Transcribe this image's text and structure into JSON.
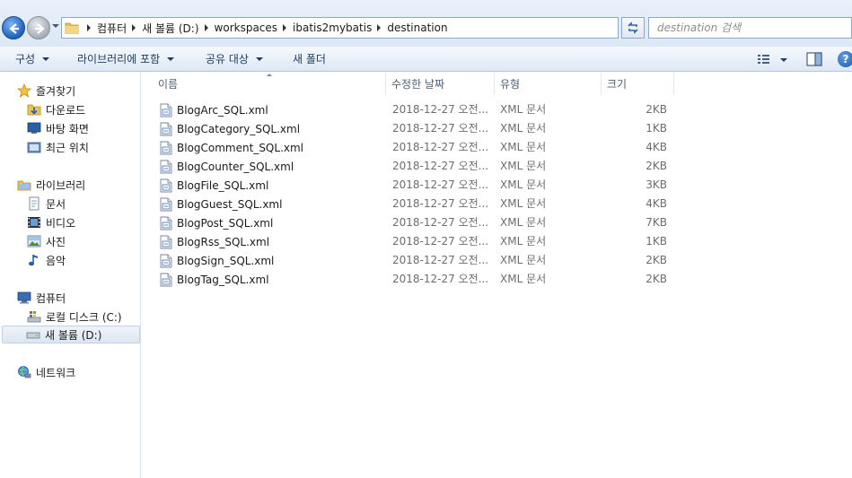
{
  "address": {
    "crumbs": [
      "컴퓨터",
      "새 볼륨 (D:)",
      "workspaces",
      "ibatis2mybatis",
      "destination"
    ]
  },
  "search": {
    "placeholder": "destination 검색"
  },
  "toolbar": {
    "organize": "구성",
    "include_library": "라이브러리에 포함",
    "share": "공유 대상",
    "new_folder": "새 폴더",
    "help": "?"
  },
  "nav": {
    "favorites": "즐겨찾기",
    "downloads": "다운로드",
    "desktop": "바탕 화면",
    "recent": "최근 위치",
    "libraries": "라이브러리",
    "documents": "문서",
    "videos": "비디오",
    "pictures": "사진",
    "music": "음악",
    "computer": "컴퓨터",
    "local_disk": "로컬 디스크 (C:)",
    "new_volume": "새 볼륨 (D:)",
    "network": "네트워크"
  },
  "columns": {
    "name": "이름",
    "modified": "수정한 날짜",
    "type": "유형",
    "size": "크기"
  },
  "files": [
    {
      "name": "BlogArc_SQL.xml",
      "date": "2018-12-27 오전...",
      "type": "XML 문서",
      "size": "2KB"
    },
    {
      "name": "BlogCategory_SQL.xml",
      "date": "2018-12-27 오전...",
      "type": "XML 문서",
      "size": "1KB"
    },
    {
      "name": "BlogComment_SQL.xml",
      "date": "2018-12-27 오전...",
      "type": "XML 문서",
      "size": "4KB"
    },
    {
      "name": "BlogCounter_SQL.xml",
      "date": "2018-12-27 오전...",
      "type": "XML 문서",
      "size": "2KB"
    },
    {
      "name": "BlogFile_SQL.xml",
      "date": "2018-12-27 오전...",
      "type": "XML 문서",
      "size": "3KB"
    },
    {
      "name": "BlogGuest_SQL.xml",
      "date": "2018-12-27 오전...",
      "type": "XML 문서",
      "size": "4KB"
    },
    {
      "name": "BlogPost_SQL.xml",
      "date": "2018-12-27 오전...",
      "type": "XML 문서",
      "size": "7KB"
    },
    {
      "name": "BlogRss_SQL.xml",
      "date": "2018-12-27 오전...",
      "type": "XML 문서",
      "size": "1KB"
    },
    {
      "name": "BlogSign_SQL.xml",
      "date": "2018-12-27 오전...",
      "type": "XML 문서",
      "size": "2KB"
    },
    {
      "name": "BlogTag_SQL.xml",
      "date": "2018-12-27 오전...",
      "type": "XML 문서",
      "size": "2KB"
    }
  ],
  "colors": {
    "accent": "#1f5fbf",
    "toolbar_text": "#1e3a5f",
    "secondary_text": "#6d6d6d"
  },
  "icons": {
    "back": "back-arrow-icon",
    "forward": "forward-arrow-icon",
    "refresh": "refresh-icon",
    "file": "xml-file-icon",
    "folder": "folder-icon"
  }
}
